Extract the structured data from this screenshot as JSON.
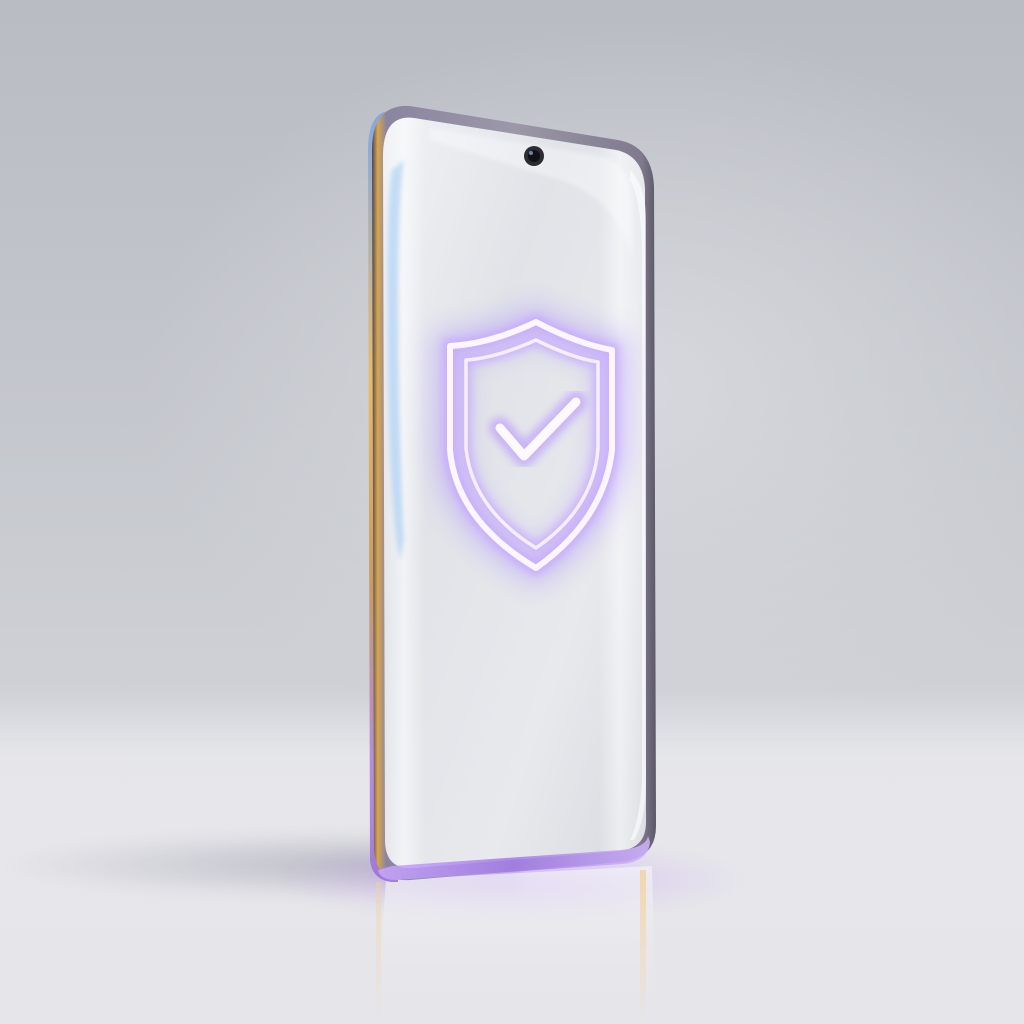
{
  "scene": {
    "subject": "smartphone",
    "screen_icon": "shield-check-icon",
    "colors": {
      "background": "#c4c7cd",
      "screen": "#e4e6ea",
      "glow_primary": "#b58cff",
      "glow_secondary": "#8fc8ff",
      "frame": "#6e6a78"
    }
  }
}
